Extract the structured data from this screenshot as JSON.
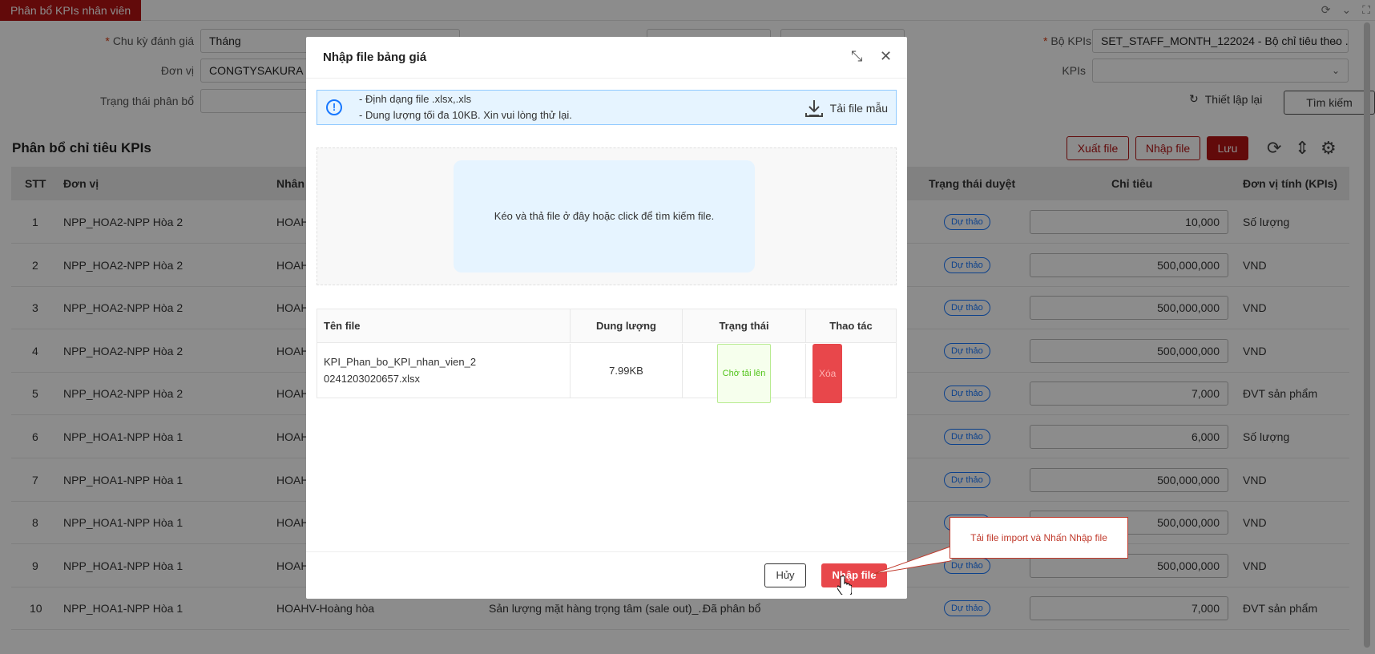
{
  "app": {
    "page_tab": "Phân bổ KPIs nhân viên"
  },
  "filters": {
    "cycle_label": "Chu kỳ đánh giá",
    "cycle_value": "Tháng",
    "unit_label": "Đơn vị",
    "unit_value": "CONGTYSAKURA - C",
    "alloc_status_label": "Trạng thái phân bổ",
    "alloc_status_value": "",
    "kpi_set_label": "Bộ KPIs",
    "kpi_set_value": "SET_STAFF_MONTH_122024 - Bộ chỉ tiêu theo ...",
    "kpis_label": "KPIs",
    "kpis_value": "",
    "reset_label": "Thiết lập lại",
    "search_label": "Tìm kiếm"
  },
  "section": {
    "title": "Phân bổ chỉ tiêu KPIs",
    "export_label": "Xuất file",
    "import_label": "Nhập file",
    "save_label": "Lưu"
  },
  "table": {
    "headers": {
      "stt": "STT",
      "unit": "Đơn vị",
      "staff": "Nhân v",
      "approval_status": "Trạng thái duyệt",
      "target": "Chỉ tiêu",
      "kpi_unit": "Đơn vị tính (KPIs)"
    },
    "rows": [
      {
        "stt": "1",
        "unit": "NPP_HOA2-NPP Hòa 2",
        "staff": "HOAH",
        "status": "Dự thảo",
        "target": "10,000",
        "kpi_unit": "Số lượng"
      },
      {
        "stt": "2",
        "unit": "NPP_HOA2-NPP Hòa 2",
        "staff": "HOAH",
        "status": "Dự thảo",
        "target": "500,000,000",
        "kpi_unit": "VND"
      },
      {
        "stt": "3",
        "unit": "NPP_HOA2-NPP Hòa 2",
        "staff": "HOAH",
        "status": "Dự thảo",
        "target": "500,000,000",
        "kpi_unit": "VND"
      },
      {
        "stt": "4",
        "unit": "NPP_HOA2-NPP Hòa 2",
        "staff": "HOAH",
        "status": "Dự thảo",
        "target": "500,000,000",
        "kpi_unit": "VND"
      },
      {
        "stt": "5",
        "unit": "NPP_HOA2-NPP Hòa 2",
        "staff": "HOAH",
        "status": "Dự thảo",
        "target": "7,000",
        "kpi_unit": "ĐVT sản phẩm"
      },
      {
        "stt": "6",
        "unit": "NPP_HOA1-NPP Hòa 1",
        "staff": "HOAH",
        "status": "Dự thảo",
        "target": "6,000",
        "kpi_unit": "Số lượng"
      },
      {
        "stt": "7",
        "unit": "NPP_HOA1-NPP Hòa 1",
        "staff": "HOAH",
        "status": "Dự thảo",
        "target": "500,000,000",
        "kpi_unit": "VND"
      },
      {
        "stt": "8",
        "unit": "NPP_HOA1-NPP Hòa 1",
        "staff": "HOAH",
        "status": "Dự thảo",
        "target": "500,000,000",
        "kpi_unit": "VND"
      },
      {
        "stt": "9",
        "unit": "NPP_HOA1-NPP Hòa 1",
        "staff": "HOAH",
        "status": "Dự thảo",
        "target": "500,000,000",
        "kpi_unit": "VND"
      },
      {
        "stt": "10",
        "unit": "NPP_HOA1-NPP Hòa 1",
        "staff": "HOAHV-Hoàng hòa",
        "kpi_name": "Sản lượng mặt hàng trọng tâm (sale out)_...",
        "alloc": "Đã phân bổ",
        "status": "Dự thảo",
        "target": "7,000",
        "kpi_unit": "ĐVT sản phẩm"
      }
    ]
  },
  "modal": {
    "title": "Nhập file bảng giá",
    "info_line1": "- Định dạng file .xlsx,.xls",
    "info_line2": "- Dung lượng tối đa 10KB. Xin vui lòng thử lại.",
    "download_label": "Tải file mẫu",
    "dropzone_text": "Kéo và thả file ở đây hoặc click để tìm kiếm file.",
    "file_table": {
      "headers": {
        "name": "Tên file",
        "size": "Dung lượng",
        "status": "Trạng thái",
        "action": "Thao tác"
      },
      "file": {
        "name_line1": "KPI_Phan_bo_KPI_nhan_vien_2",
        "name_line2": "0241203020657.xlsx",
        "size": "7.99KB",
        "status": "Chờ tải lên",
        "delete_label": "Xóa"
      }
    },
    "cancel_label": "Hủy",
    "import_label": "Nhập file"
  },
  "callout": {
    "text": "Tải file import và Nhấn Nhập file"
  },
  "colors": {
    "brand": "#b31313",
    "primary_button": "#e8474b",
    "info_bg": "#e6f4ff",
    "badge_blue": "#1677ff",
    "success": "#52c41a"
  }
}
